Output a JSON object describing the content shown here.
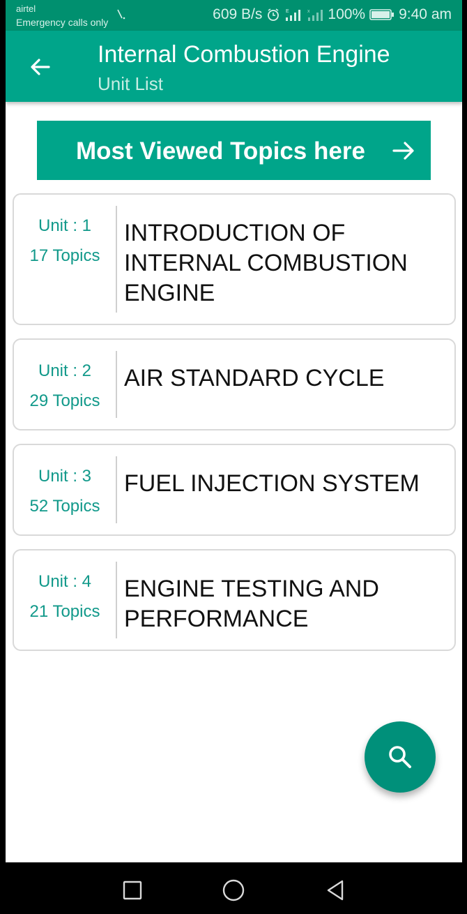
{
  "status_bar": {
    "carrier": "airtel",
    "emergency": "Emergency calls only",
    "net_speed": "609 B/s",
    "battery": "100%",
    "time": "9:40 am",
    "icons": [
      "alarm-icon",
      "signal-icon",
      "signal-x-icon",
      "battery-icon"
    ]
  },
  "app_bar": {
    "title": "Internal Combustion Engine",
    "subtitle": "Unit List",
    "back_icon": "arrow-left-icon"
  },
  "banner": {
    "label": "Most Viewed Topics here",
    "icon": "arrow-right-icon"
  },
  "units": [
    {
      "unit": "Unit : 1",
      "topics": "17 Topics",
      "title": "INTRODUCTION OF INTERNAL COMBUSTION ENGINE"
    },
    {
      "unit": "Unit : 2",
      "topics": "29 Topics",
      "title": "AIR STANDARD CYCLE"
    },
    {
      "unit": "Unit : 3",
      "topics": "52 Topics",
      "title": "FUEL INJECTION SYSTEM"
    },
    {
      "unit": "Unit : 4",
      "topics": "21 Topics",
      "title": "ENGINE TESTING AND PERFORMANCE"
    }
  ],
  "fab": {
    "icon": "search-icon"
  },
  "nav_bar": {
    "icons": [
      "recents-square-icon",
      "home-circle-icon",
      "back-triangle-icon"
    ]
  },
  "colors": {
    "status_bar": "#00906f",
    "primary": "#00a58a",
    "accent_text": "#11998a",
    "fab": "#00907a"
  }
}
